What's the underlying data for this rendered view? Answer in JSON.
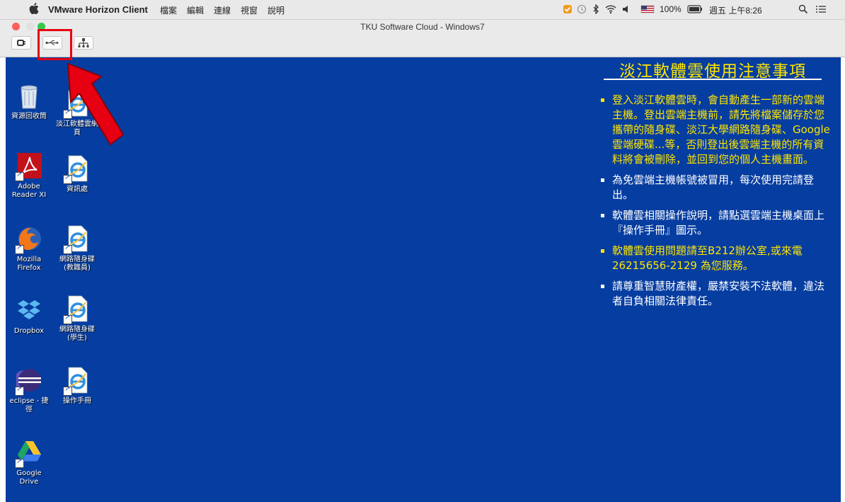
{
  "menubar": {
    "app_name": "VMware Horizon Client",
    "menus": [
      "檔案",
      "編輯",
      "連線",
      "視窗",
      "說明"
    ],
    "battery": "100%",
    "clock": "週五 上午8:26"
  },
  "window": {
    "title": "TKU Software Cloud - Windows7"
  },
  "toolbar": {
    "buttons": [
      "disconnect-icon",
      "usb-icon",
      "network-icon"
    ]
  },
  "desktop": {
    "icons": [
      {
        "label": "資源回收筒",
        "icon": "recycle-bin-icon"
      },
      {
        "label": "淡江軟體雲網頁",
        "icon": "ie-icon"
      },
      {
        "label": "Adobe Reader XI",
        "icon": "adobe-reader-icon"
      },
      {
        "label": "資訊處",
        "icon": "ie-icon"
      },
      {
        "label": "Mozilla Firefox",
        "icon": "firefox-icon"
      },
      {
        "label": "網路隨身碟(教職員)",
        "icon": "ie-icon"
      },
      {
        "label": "Dropbox",
        "icon": "dropbox-icon"
      },
      {
        "label": "網路隨身碟(學生)",
        "icon": "ie-icon"
      },
      {
        "label": "eclipse - 捷徑",
        "icon": "eclipse-icon"
      },
      {
        "label": "操作手冊",
        "icon": "ie-icon"
      },
      {
        "label": "Google Drive",
        "icon": "google-drive-icon"
      }
    ]
  },
  "notice": {
    "title": "淡江軟體雲使用注意事項",
    "items": [
      {
        "text": "登入淡江軟體雲時，會自動產生一部新的雲端主機。登出雲端主機前，請先將檔案儲存於您攜帶的隨身碟、淡江大學網路隨身碟、Google雲端硬碟...等，否則登出後雲端主機的所有資料將會被刪除，並回到您的個人主機畫面。",
        "color": "#ffe600"
      },
      {
        "text": "為免雲端主機帳號被冒用，每次使用完請登出。",
        "color": "#ffffff"
      },
      {
        "text": "軟體雲相關操作說明，請點選雲端主機桌面上『操作手冊』圖示。",
        "color": "#ffffff"
      },
      {
        "text": "軟體雲使用問題請至B212辦公室,或來電26215656-2129 為您服務。",
        "color": "#ffe600"
      },
      {
        "text": "請尊重智慧財產權，嚴禁安裝不法軟體，違法者自負相關法律責任。",
        "color": "#ffffff"
      }
    ]
  },
  "colors": {
    "desktop_bg": "#063da0",
    "highlight": "#e60012",
    "notice_yellow": "#ffe600"
  }
}
